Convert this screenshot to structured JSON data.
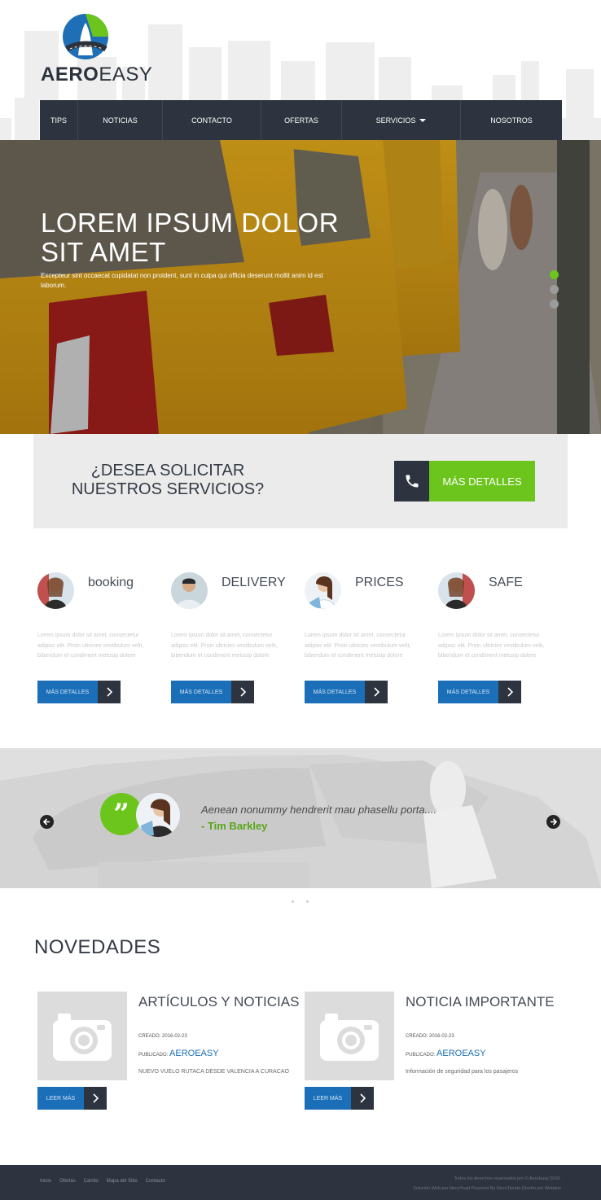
{
  "brand": {
    "name_bold": "AERO",
    "name_light": "EASY"
  },
  "nav": {
    "items": [
      {
        "label": "TIPS"
      },
      {
        "label": "NOTICIAS"
      },
      {
        "label": "CONTACTO"
      },
      {
        "label": "OFERTAS"
      },
      {
        "label": "SERVICIOS",
        "dropdown": true
      },
      {
        "label": "NOSOTROS"
      }
    ]
  },
  "hero": {
    "title": "LOREM IPSUM DOLOR SIT AMET",
    "text": "Excepteur sint occaecat cupidatat non proident, sunt in culpa qui officia deserunt mollit anim id est laborum.",
    "slide_count": 3,
    "active_slide": 1
  },
  "cta": {
    "text": "¿DESEA SOLICITAR NUESTROS SERVICIOS?",
    "button_label": "MÁS DETALLES",
    "icon": "phone-icon"
  },
  "features": [
    {
      "title": "booking",
      "text": "Lorem ipsum dolor sit amet, consectetur adipisc elit. Proin ultricies vestibulum velit, bibendum et condiment metusip dolore",
      "button": "MÁS DETALLES"
    },
    {
      "title": "DELIVERY",
      "text": "Lorem ipsum dolor sit amet, consectetur adipisc elit. Proin ultricies vestibulum velit, bibendum et condiment metusip dolore",
      "button": "MÁS DETALLES"
    },
    {
      "title": "PRICES",
      "text": "Lorem ipsum dolor sit amet, consectetur adipisc elit. Proin ultricies vestibulum velit, bibendum et condiment metusip dolore",
      "button": "MÁS DETALLES"
    },
    {
      "title": "SAFE",
      "text": "Lorem ipsum dolor sit amet, consectetur adipisc elit. Proin ultricies vestibulum velit, bibendum et condiment metusip dolore",
      "button": "MÁS DETALLES"
    }
  ],
  "testimonial": {
    "quote": "Aenean nonummy hendrerit mau phasellu porta....",
    "author": "- Tim Barkley"
  },
  "news": {
    "heading": "NOVEDADES",
    "items": [
      {
        "title": "ARTÍCULOS Y NOTICIAS",
        "created_label": "CREADO:",
        "created": "2016-02-23",
        "published_label": "PUBLICADO:",
        "author": "AEROEASY",
        "desc": "NUEVO VUELO RUTACA DESDE VALENCIA A CURACAO",
        "button": "LEER MÁS"
      },
      {
        "title": "NOTICIA IMPORTANTE",
        "created_label": "CREADO:",
        "created": "2016-02-23",
        "published_label": "PUBLICADO:",
        "author": "AEROEASY",
        "desc": "Información de seguridad para los pasajeros",
        "button": "LEER MÁS"
      }
    ]
  },
  "footer": {
    "links": [
      "Inicio",
      "Ofertas",
      "Carrito",
      "Mapa del Sitio",
      "Contacto"
    ],
    "copyright": "Todos los derechos reservados por © AeroEasy 2016.",
    "credits": "Solución Web por NecoYoad Powered By NecoTienda Diseño por Webtino"
  },
  "colors": {
    "accent_green": "#6cc51c",
    "accent_blue": "#1a6fb8",
    "dark": "#2d343f",
    "hero_taxi": "#e1a81b"
  }
}
